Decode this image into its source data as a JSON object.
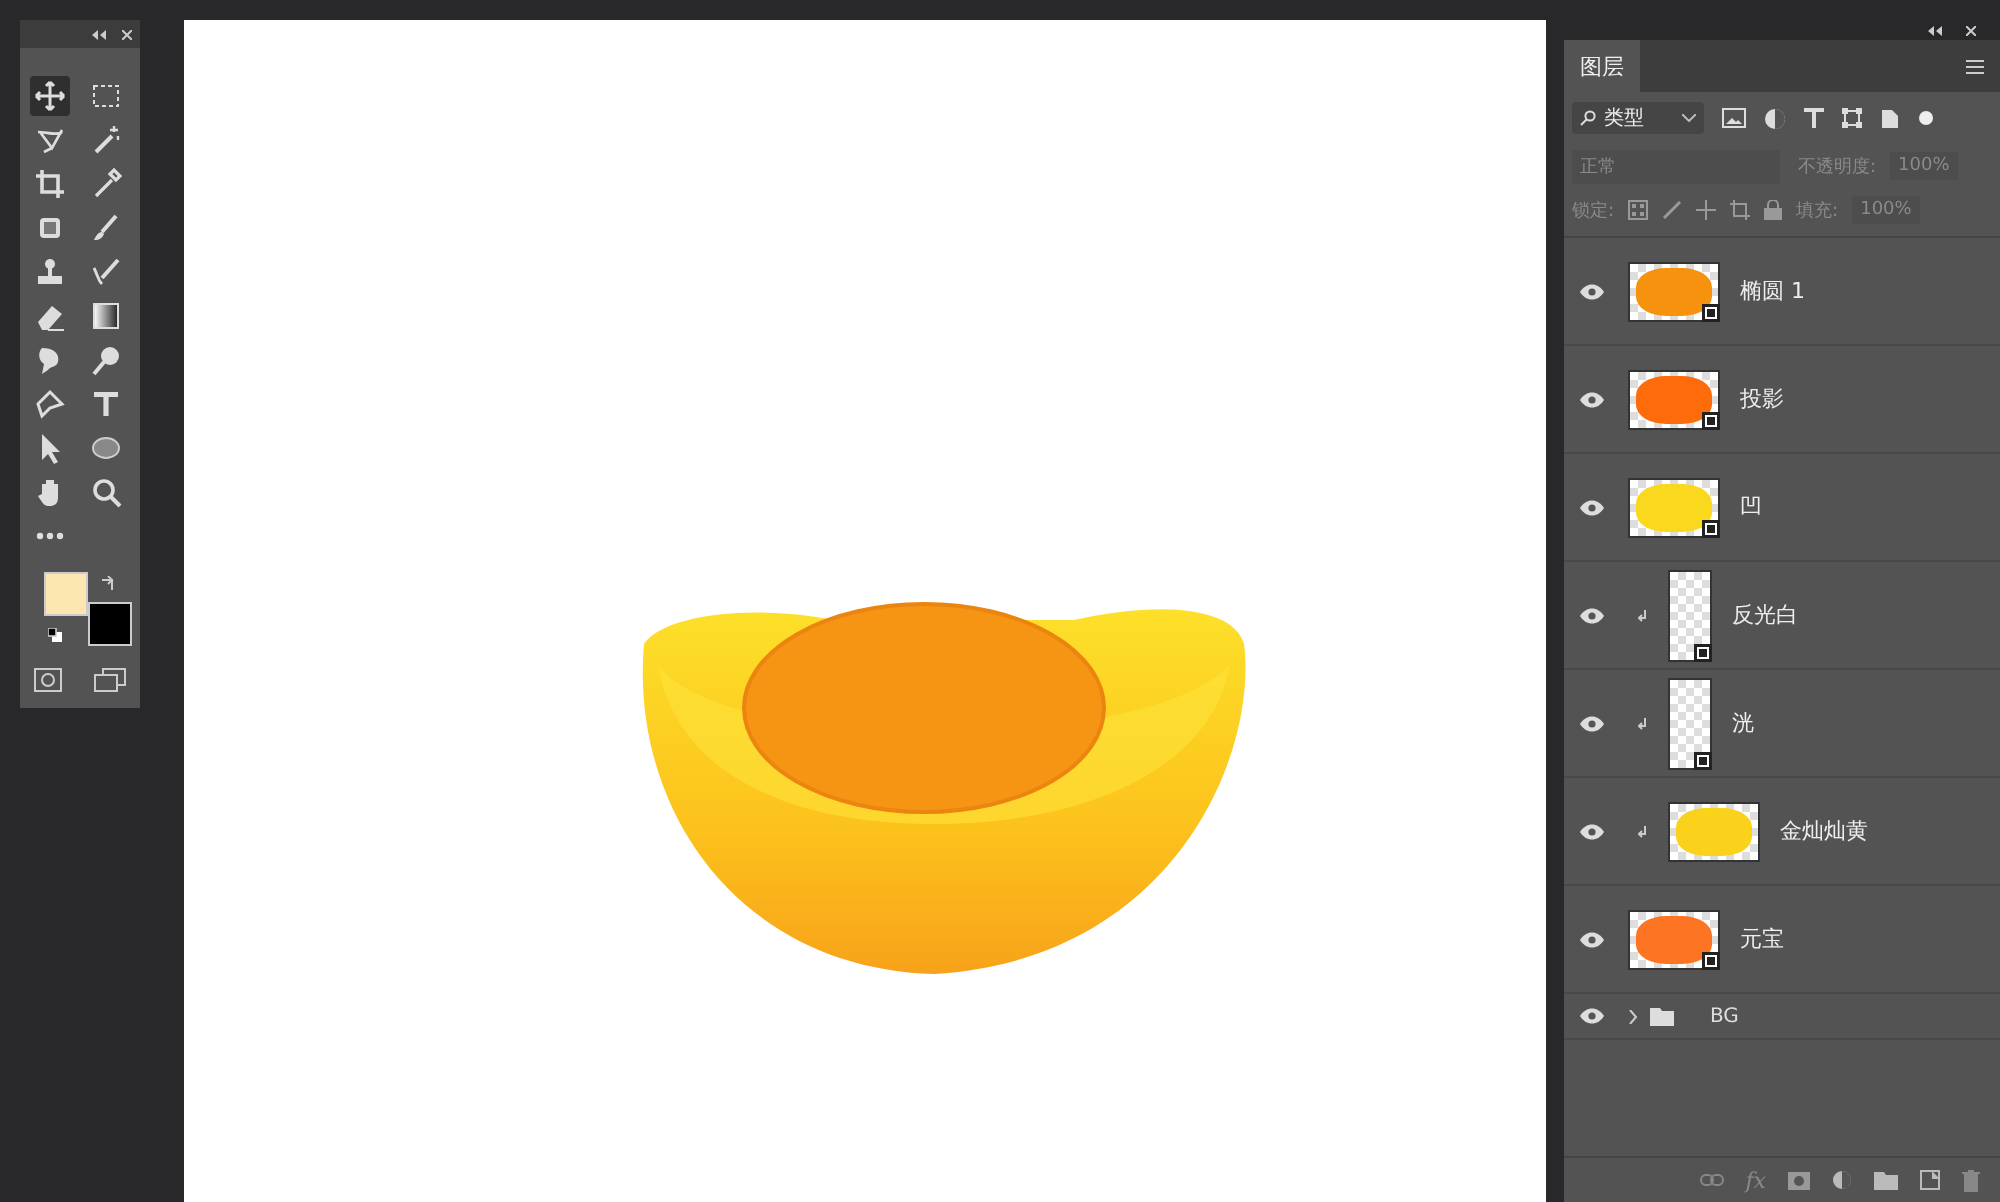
{
  "tools": [
    {
      "kind": "move",
      "selected": true
    },
    {
      "kind": "marquee",
      "selected": false
    },
    {
      "kind": "lasso",
      "selected": false
    },
    {
      "kind": "wand",
      "selected": false
    },
    {
      "kind": "crop",
      "selected": false
    },
    {
      "kind": "eyedropper",
      "selected": false
    },
    {
      "kind": "patch",
      "selected": false
    },
    {
      "kind": "brush",
      "selected": false
    },
    {
      "kind": "stamp",
      "selected": false
    },
    {
      "kind": "history",
      "selected": false
    },
    {
      "kind": "eraser",
      "selected": false
    },
    {
      "kind": "gradient",
      "selected": false
    },
    {
      "kind": "smudge",
      "selected": false
    },
    {
      "kind": "dodge",
      "selected": false
    },
    {
      "kind": "pen",
      "selected": false
    },
    {
      "kind": "type",
      "selected": false
    },
    {
      "kind": "select",
      "selected": false
    },
    {
      "kind": "ellipse",
      "selected": false
    },
    {
      "kind": "hand",
      "selected": false
    },
    {
      "kind": "zoom",
      "selected": false
    }
  ],
  "swatches": [
    {
      "kind": "foreground",
      "color": "#fce7b0"
    },
    {
      "kind": "background",
      "color": "#000000"
    }
  ],
  "layers_panel": {
    "tab": "图层",
    "filter": {
      "value": "类型"
    },
    "blend_mode": "正常",
    "opacity": {
      "label": "不透明度:",
      "value": "100%"
    },
    "lock_label": "锁定:",
    "fill": {
      "label": "填充:",
      "value": "100%"
    },
    "fx_label": "fx"
  },
  "layers": [
    {
      "kind": "layer",
      "name": "椭圆 1",
      "visible": true,
      "clipped": false,
      "tall": false,
      "color": "#f7920f",
      "badge": true
    },
    {
      "kind": "layer",
      "name": "投影",
      "visible": true,
      "clipped": false,
      "tall": false,
      "color": "#fd6b0b",
      "badge": true
    },
    {
      "kind": "layer",
      "name": "凹",
      "visible": true,
      "clipped": false,
      "tall": false,
      "color": "#f9d81e",
      "badge": true
    },
    {
      "kind": "layer",
      "name": "反光白",
      "visible": true,
      "clipped": true,
      "tall": true,
      "color": "#ffffff",
      "badge": true
    },
    {
      "kind": "layer",
      "name": "洸",
      "visible": true,
      "clipped": true,
      "tall": true,
      "color": "#ffffff",
      "badge": true
    },
    {
      "kind": "layer",
      "name": "金灿灿黄",
      "visible": true,
      "clipped": true,
      "tall": false,
      "color": "#fad21c",
      "badge": false
    },
    {
      "kind": "layer",
      "name": "元宝",
      "visible": true,
      "clipped": false,
      "tall": false,
      "color": "#fd7523",
      "badge": true
    },
    {
      "kind": "group",
      "name": "BG",
      "visible": true,
      "expanded": false
    }
  ]
}
